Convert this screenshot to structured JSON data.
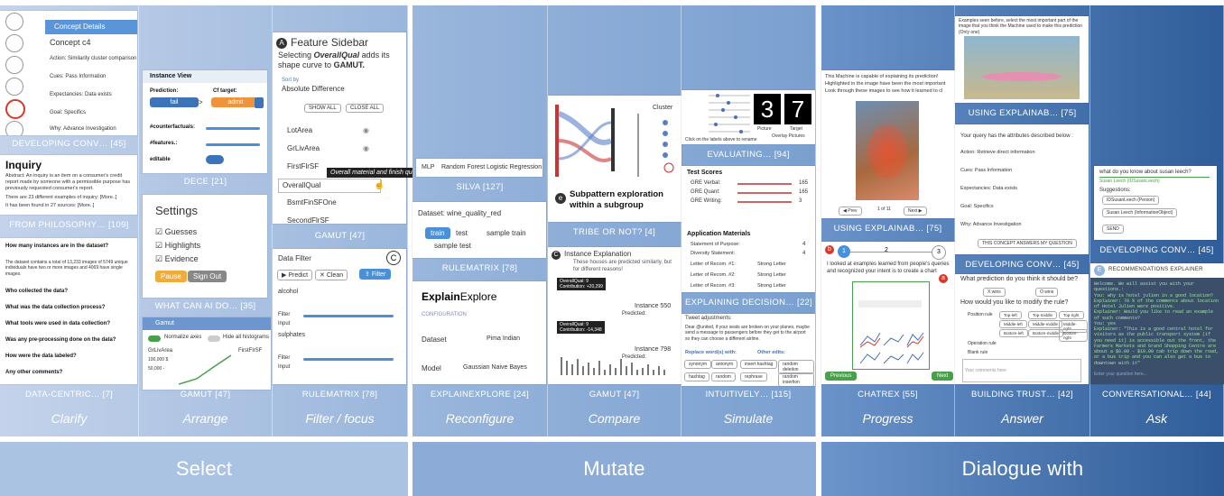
{
  "groups": [
    {
      "label": "Select",
      "verbs": [
        "Clarify",
        "Arrange",
        "Filter / focus"
      ]
    },
    {
      "label": "Mutate",
      "verbs": [
        "Reconfigure",
        "Compare",
        "Simulate"
      ]
    },
    {
      "label": "Dialogue with",
      "verbs": [
        "Progress",
        "Answer",
        "Ask"
      ]
    }
  ],
  "captions": {
    "developing_conv_1": "DEVELOPING CONV… [45]",
    "from_philosophy": "FROM PHILOSOPHY… [109]",
    "data_centric": "DATA-CENTRIC… [7]",
    "dece": "DECE [21]",
    "what_can_ai": "WHAT CAN AI DO… [35]",
    "gamut_1": "GAMUT [47]",
    "gamut_2": "GAMUT [47]",
    "rulematrix_1": "RULEMATRIX [78]",
    "silva": "SILVA [127]",
    "tribe": "TRIBE OR NOT? [4]",
    "rulematrix_2": "RULEMATRIX [78]",
    "explainexplore": "EXPLAINEXPLORE [24]",
    "gamut_3": "GAMUT [47]",
    "evaluating": "EVALUATING… [94]",
    "explaining_decision": "EXPLAINING DECISION… [22]",
    "intuitively": "INTUITIVELY… [115]",
    "using_explainab_1": "USING EXPLAINAB… [75]",
    "chatrex": "CHATREX [55]",
    "using_explainab_2": "USING EXPLAINAB… [75]",
    "developing_conv_2": "DEVELOPING CONV… [45]",
    "building_trust": "BUILDING TRUST… [42]",
    "developing_conv_3": "DEVELOPING CONV… [45]",
    "conversational": "CONVERSATIONAL… [44]"
  },
  "shots": {
    "concept": {
      "title": "Concept Details",
      "name": "Concept c4",
      "rows": [
        "Action: Similarity cluster comparison",
        "Cues: Pass Information",
        "Expectancies: Data exists",
        "Goal: Specifics",
        "Why: Advance Investigation"
      ]
    },
    "inquiry": {
      "title": "Inquiry",
      "abstract": "Abstract: An inquiry is an item on a consumer's credit report made by someone with a permissible purpose has previously requested consumer's report.",
      "b2": "There are 23 different examples of inquiry: [More..]",
      "b3": "It has been found in 27 sources: [More..]"
    },
    "data_centric": {
      "q1": "How many instances are in the dataset?",
      "body": "The dataset contains a total of 13,233 images of 5749 unique individuals have two or more images and 4069 have single images.",
      "q2": "Who collected the data?",
      "q3": "What was the data collection process?",
      "q4": "What tools were used in data collection?",
      "q5": "Was any pre-processing done on the data?",
      "q6": "How were the data labeled?",
      "q7": "Any other comments?"
    },
    "dece": {
      "title": "Instance View",
      "pred_label": "Prediction:",
      "cf_label": "Cf target:",
      "fail": "fail",
      "admit": "admit",
      "n_cf": "#counterfactuals:",
      "n_feat": "#features.:",
      "editable": "editable"
    },
    "settings": {
      "title": "Settings",
      "o1": "Guesses",
      "o2": "Highlights",
      "o3": "Evidence",
      "pause": "Pause",
      "signout": "Sign Out"
    },
    "gamut_arrange": {
      "title": "Gamut",
      "normalize": "Normalize axes",
      "hide": "Hide all histograms",
      "a1": "GrLivArea",
      "a2": "FirstFlrSF",
      "v1": "100,000 $",
      "v2": "50,000 -"
    },
    "feature_sidebar": {
      "badge": "A",
      "title": "Feature Sidebar",
      "sub1": "Selecting",
      "sub_em": "OverallQual",
      "sub2": "adds its shape curve to",
      "sub3": "GAMUT.",
      "sortby": "Sort by",
      "sortval": "Absolute Difference",
      "showall": "SHOW ALL",
      "closeall": "CLOSE ALL",
      "f1": "LotArea",
      "f2": "GrLivArea",
      "f3": "FirstFlrSF",
      "f4": "OverallQual",
      "f5": "BsmtFinSFOne",
      "f6": "SecondFlrSF",
      "tooltip": "Overall material and finish quality"
    },
    "data_filter": {
      "title": "Data Filter",
      "badge": "C",
      "predict": "Predict",
      "clean": "Clean",
      "filter": "Filter",
      "alcohol": "alcohol",
      "sulphates": "sulphates",
      "filter_l": "Filter",
      "input_l": "Input"
    },
    "silva": {
      "t1": "MLP",
      "t2": "Random Forest",
      "t3": "Logistic Regression"
    },
    "rulematrix": {
      "dataset": "Dataset: wine_quality_red",
      "train": "train",
      "test": "test",
      "sample_train": "sample train",
      "sample_test": "sample test"
    },
    "explainexplore": {
      "brand1": "Explain",
      "brand2": "Explore",
      "config": "CONFIGURATION",
      "dataset": "Dataset",
      "dataset_val": "Pima Indian",
      "model": "Model",
      "model_val": "Gaussian Naive Bayes"
    },
    "tribe": {
      "cluster": "Cluster",
      "badge": "e",
      "headline": "Subpattern exploration within a subgroup"
    },
    "instance_expl": {
      "badge": "C",
      "title": "Instance Explanation",
      "sub": "These houses are predicted similarly, but for different reasons!",
      "tag1a": "OverallQual: 9",
      "tag1b": "Contribution: +20,299",
      "tag2a": "OverallQual: 9",
      "tag2b": "Contribution: -14,348",
      "inst1": "Instance 550",
      "pred1": "Predicted:",
      "inst2": "Instance 798",
      "pred2": "Predicted:"
    },
    "evaluating": {
      "picture": "Picture",
      "target": "Target",
      "digit": "37",
      "overlay": "Overlay Pictures",
      "note": "Click on the labels above to rename"
    },
    "explaining": {
      "h1": "Test Scores",
      "s1": "GRE Verbal:",
      "s2": "GRE Quant:",
      "s3": "GRE Writing:",
      "v1": "165",
      "v2": "165",
      "v3": "3",
      "h2": "Application Materials",
      "m1": "Statement of Purpose:",
      "m2": "Diversity Statement:",
      "m3": "Letter of Recom. #1:",
      "m4": "Letter of Recom. #2:",
      "m5": "Letter of Recom. #3:",
      "mv1": "4",
      "mv2": "4",
      "lv": "Strong Letter"
    },
    "intuitively": {
      "h": "Tweet adjustments:",
      "body": "Dear @united, if your seats are broken on your planes, maybe send a message to passengers before they get to the airport so they can choose a different airline.",
      "replace": "Replace word(s) with:",
      "other": "Other edits:",
      "c1": "synonym",
      "c2": "antonym",
      "c3": "insert hashtag",
      "c4": "random deletion",
      "c5": "hashtag",
      "c6": "random",
      "c7": "rephrase",
      "c8": "random insertion"
    },
    "using1": {
      "l1": "This Machine is capable of explaining its prediction!",
      "l2": "Highlighted in the image have been the most important",
      "l3": "Look through these images to see how it learned to cl",
      "prev": "Prev",
      "page": "1 of 11",
      "next": "Next"
    },
    "chatrex": {
      "b": "b",
      "s1": "1",
      "s2": "2",
      "s3": "3",
      "msg": "I looked at examples learned from people's queries and recognized your intent is to create a chart",
      "cta": "create a chart",
      "a": "a",
      "prev": "Previous",
      "next": "Next"
    },
    "using2": {
      "l1": "Examples seen before, select the most important part of the image that you think the Machine used to make this prediction (Only one)"
    },
    "dev_conv2": {
      "intro": "Your query has the attributes described below :",
      "r1": "Action: Retrieve direct information",
      "r2": "Cues: Pass Information",
      "r3": "Expectancies: Data exists",
      "r4": "Goal: Specifics",
      "r5": "Why: Advance Investigation",
      "btn": "THIS CONCEPT ANSWERS MY QUESTION"
    },
    "building": {
      "q1": "What prediction do you think it should be?",
      "x": "X wins",
      "o": "O wins",
      "q2": "How would you like to modify the rule?",
      "p": "Position rule",
      "t1": "Top-left",
      "t2": "Top-middle",
      "t3": "Top-right",
      "m1": "Middle-left",
      "m2": "Middle-middle",
      "m3": "Middle-right",
      "b1": "Bottom-left",
      "b2": "Bottom-middle",
      "b3": "Bottom-right",
      "op": "Operation rule",
      "blank": "Blank rule",
      "comment": "Your comments here"
    },
    "dev_conv3": {
      "q": "what do you know about susan leech?",
      "a": "Susan Leech (IDSusanLeech)",
      "sugg": "Suggestions:",
      "c1": "IDSusanLeech (Person)",
      "c2": "Susan Leech (InformationObject)",
      "send": "SEND"
    },
    "conversational": {
      "badge": "E",
      "title": "RECOMMENDATIONS EXPLAINER",
      "chat": "Welcome. We will assist you with your questions.:\nYou: why is hotel julien in a good location?\nExplainer: 70 % of the comments about location of Hotel Julien were positive.\nExplainer: Would you like to read an example of such comments?\nYou: yes\nExplainer: \"This is a good central hotel for visitors as the public transport system (if you need it) is accessible out the front, the Farmers Markets and Grand Shopping Centre are about a $6.00 - $10.00 cab trip down the road, or a bus trip and you can also get a bus to downtown with it\"",
      "placeholder": "Enter your question here..."
    }
  },
  "colors": {
    "select_bg": "#a9c1e0",
    "mutate_bg": "#86a9d4",
    "dialogue_bg": "#4f7fbd",
    "accent_orange": "#f0943b",
    "accent_blue": "#3d73b9",
    "red": "#d9382a",
    "green": "#48a04a"
  }
}
